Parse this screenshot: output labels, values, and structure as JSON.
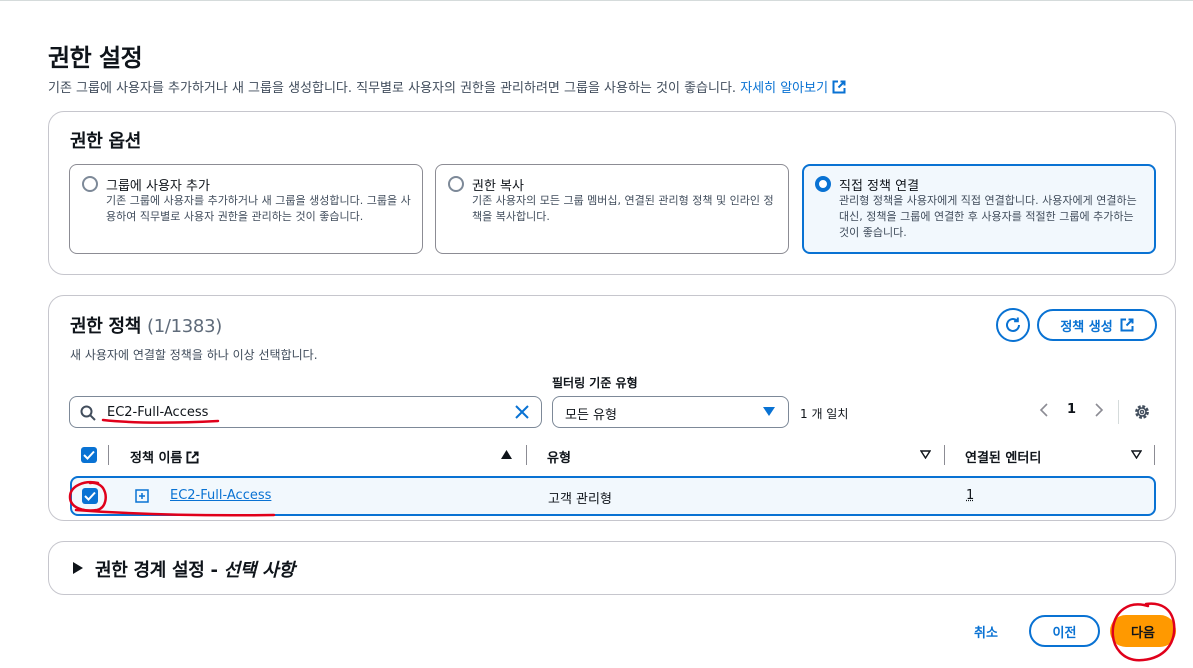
{
  "page": {
    "title": "권한 설정",
    "description": "기존 그룹에 사용자를 추가하거나 새 그룹을 생성합니다. 직무별로 사용자의 권한을 관리하려면 그룹을 사용하는 것이 좋습니다.",
    "learn_more": "자세히 알아보기"
  },
  "options": {
    "title": "권한 옵션",
    "items": [
      {
        "label": "그룹에 사용자 추가",
        "desc": "기존 그룹에 사용자를 추가하거나 새 그룹을 생성합니다. 그룹을 사용하여 직무별로 사용자 권한을 관리하는 것이 좋습니다.",
        "selected": false
      },
      {
        "label": "권한 복사",
        "desc": "기존 사용자의 모든 그룹 멤버십, 연결된 관리형 정책 및 인라인 정책을 복사합니다.",
        "selected": false
      },
      {
        "label": "직접 정책 연결",
        "desc": "관리형 정책을 사용자에게 직접 연결합니다. 사용자에게 연결하는 대신, 정책을 그룹에 연결한 후 사용자를 적절한 그룹에 추가하는 것이 좋습니다.",
        "selected": true
      }
    ]
  },
  "policies": {
    "title": "권한 정책",
    "count": "(1/1383)",
    "description": "새 사용자에 연결할 정책을 하나 이상 선택합니다.",
    "create_button": "정책 생성",
    "filter_label": "필터링 기준 유형",
    "search_value": "EC2-Full-Access",
    "type_select": "모든 유형",
    "match_text": "1 개 일치",
    "page_number": "1",
    "columns": {
      "name": "정책 이름",
      "type": "유형",
      "entities": "연결된 엔터티"
    },
    "rows": [
      {
        "name": "EC2-Full-Access",
        "type": "고객 관리형",
        "entities": "1",
        "checked": true
      }
    ]
  },
  "boundary": {
    "title": "권한 경계 설정 - ",
    "optional": "선택 사항"
  },
  "footer": {
    "cancel": "취소",
    "previous": "이전",
    "next": "다음"
  },
  "colors": {
    "primary": "#0972d3",
    "accent": "#ff9900",
    "annotation": "#e0001b"
  }
}
